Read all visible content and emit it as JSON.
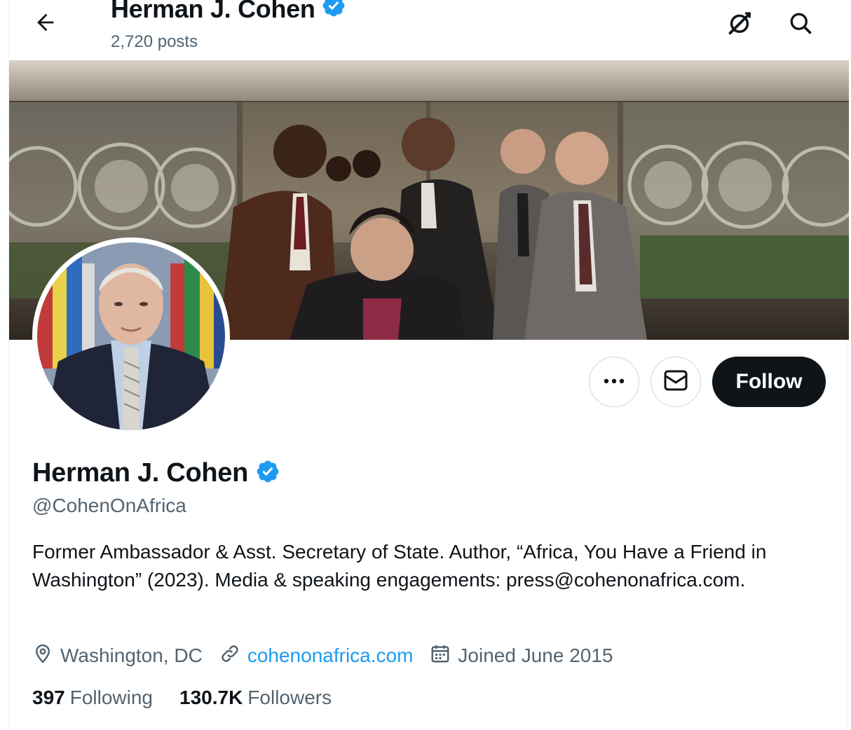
{
  "header": {
    "title": "Herman J. Cohen",
    "posts": "2,720 posts"
  },
  "profile": {
    "name": "Herman J. Cohen",
    "handle": "@CohenOnAfrica",
    "verified": true,
    "bio": "Former Ambassador & Asst. Secretary of State. Author, “Africa, You Have a Friend in Washington” (2023). Media & speaking engagements: press@cohenonafrica.com.",
    "location": "Washington, DC",
    "website": "cohenonafrica.com",
    "joined": "Joined June 2015"
  },
  "actions": {
    "follow_label": "Follow"
  },
  "stats": {
    "following_count": "397",
    "following_label": "Following",
    "followers_count": "130.7K",
    "followers_label": "Followers"
  },
  "icons": {
    "back": "arrow-left-icon",
    "grok": "grok-icon",
    "search": "search-icon",
    "more": "more-dots-icon",
    "message": "envelope-icon",
    "location": "location-pin-icon",
    "link": "link-icon",
    "calendar": "calendar-icon",
    "verified": "verified-badge-icon"
  },
  "colors": {
    "accent": "#1d9bf0",
    "text": "#0f1419",
    "muted": "#536471",
    "follow_bg": "#0f1419"
  }
}
